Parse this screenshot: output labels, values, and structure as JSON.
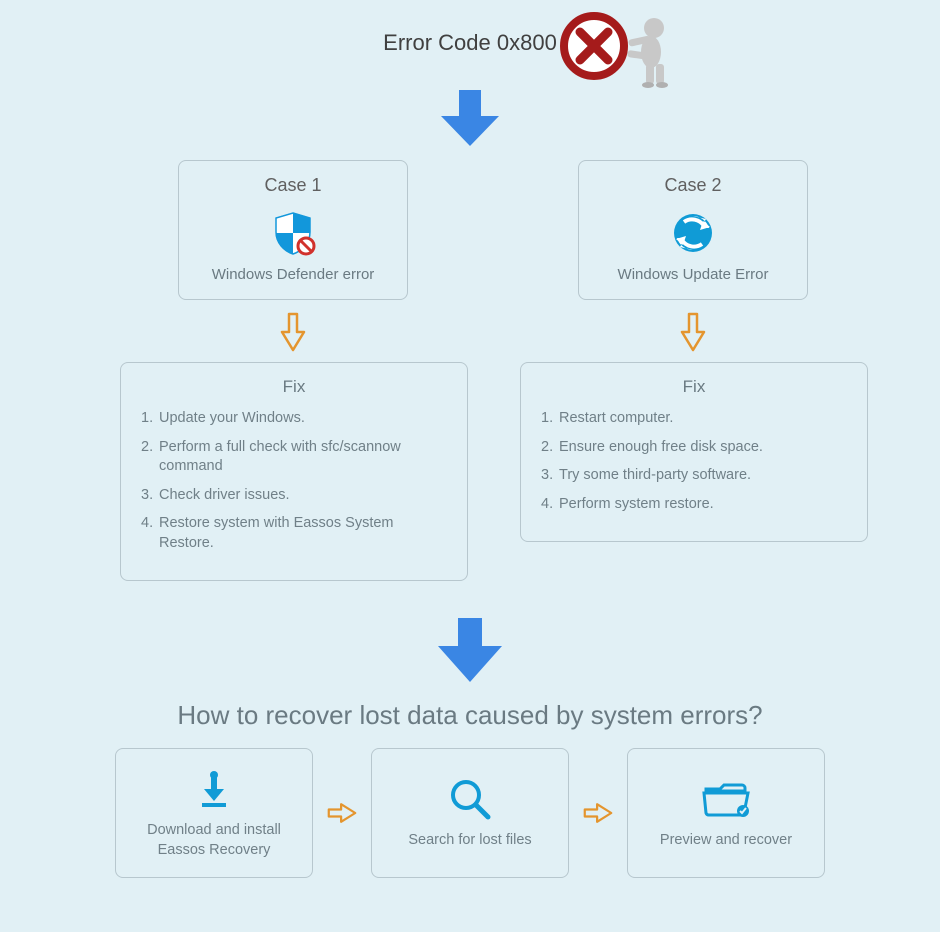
{
  "title": "Error Code 0x800",
  "cases": [
    {
      "title": "Case 1",
      "desc": "Windows Defender error"
    },
    {
      "title": "Case 2",
      "desc": "Windows Update Error"
    }
  ],
  "fixes": [
    {
      "heading": "Fix",
      "items": [
        "Update your Windows.",
        "Perform a full check with sfc/scannow command",
        "Check driver issues.",
        "Restore system with Eassos System Restore."
      ]
    },
    {
      "heading": "Fix",
      "items": [
        "Restart computer.",
        "Ensure enough free disk space.",
        "Try some third-party software.",
        "Perform system restore."
      ]
    }
  ],
  "recover_heading": "How to recover lost data caused by system errors?",
  "steps": [
    "Download and install Eassos Recovery",
    "Search for lost files",
    "Preview and recover"
  ]
}
